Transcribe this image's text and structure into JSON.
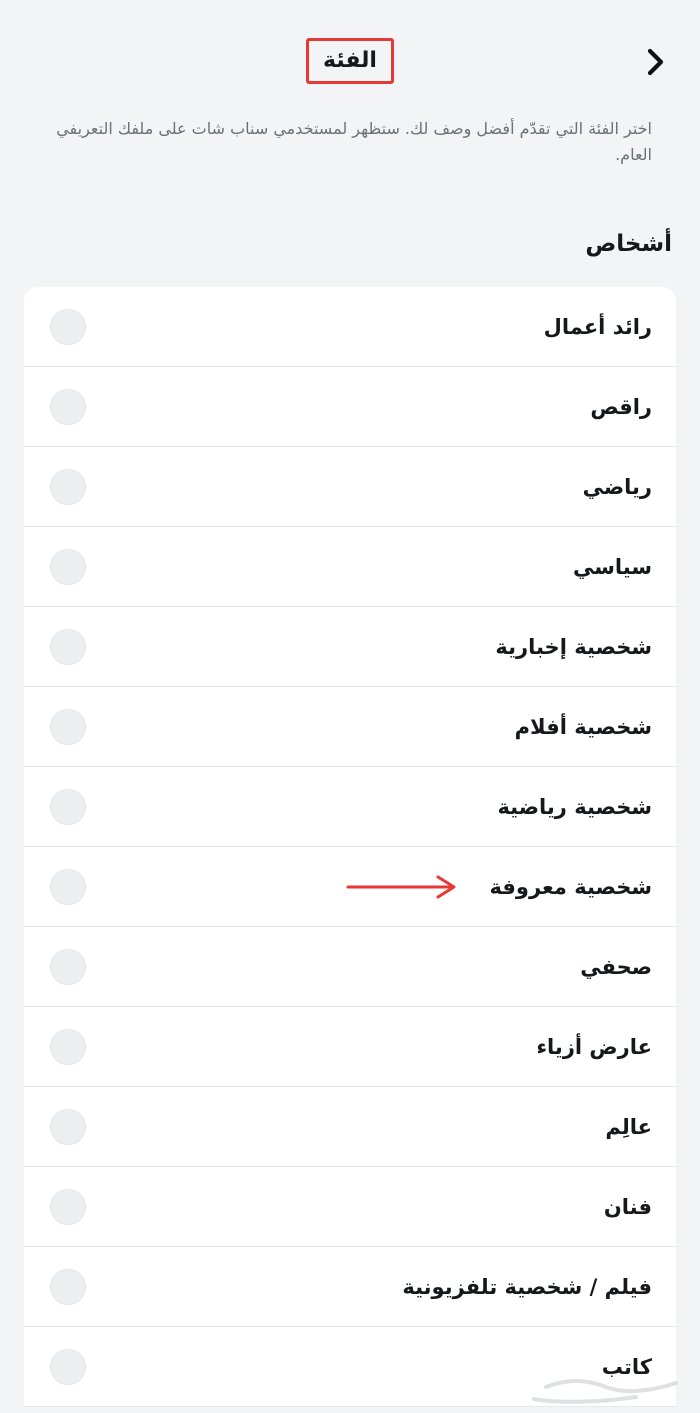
{
  "header": {
    "title": "الفئة",
    "back_icon": "chevron-right-icon"
  },
  "subtitle": "اختر الفئة التي تقدّم أفضل وصف لك. ستظهر لمستخدمي سناب شات على ملفك التعريفي العام.",
  "section": {
    "title": "أشخاص"
  },
  "categories": [
    {
      "label": "رائد أعمال"
    },
    {
      "label": "راقص"
    },
    {
      "label": "رياضي"
    },
    {
      "label": "سياسي"
    },
    {
      "label": "شخصية إخبارية"
    },
    {
      "label": "شخصية أفلام"
    },
    {
      "label": "شخصية رياضية"
    },
    {
      "label": "شخصية معروفة",
      "annotated": true
    },
    {
      "label": "صحفي"
    },
    {
      "label": "عارض أزياء"
    },
    {
      "label": "عالِم"
    },
    {
      "label": "فنان"
    },
    {
      "label": "فيلم / شخصية تلفزيونية"
    },
    {
      "label": "كاتب"
    }
  ],
  "colors": {
    "background": "#f3f4f6",
    "card": "#ffffff",
    "annotation_red": "#e53935",
    "radio_fill": "#eceef0",
    "divider": "#e6e8ea",
    "subtitle_text": "#6b7178"
  }
}
